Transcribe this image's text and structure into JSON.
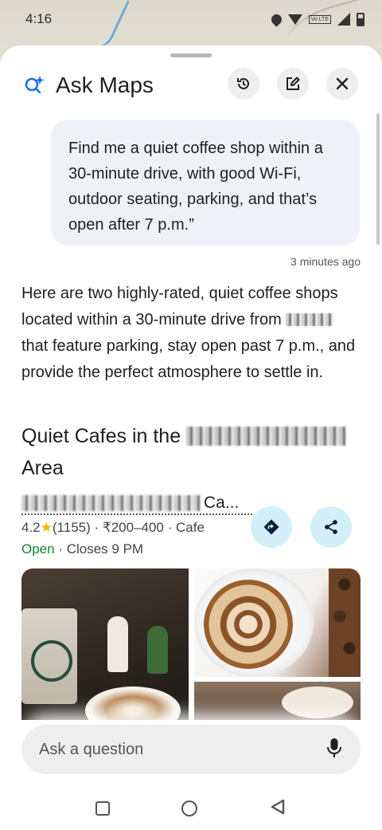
{
  "status_bar": {
    "time": "4:16",
    "icons": [
      "location-icon",
      "wifi-icon",
      "volte-icon",
      "signal-icon",
      "battery-icon"
    ]
  },
  "header": {
    "title": "Ask Maps",
    "icons": [
      "ask-maps-sparkle-icon",
      "history-icon",
      "edit-icon",
      "close-icon"
    ]
  },
  "conversation": {
    "user_message": "Find me a quiet coffee shop within a 30-minute drive, with good Wi-Fi, outdoor seating, parking, and that’s open after 7 p.m.”",
    "timestamp": "3 minutes ago",
    "answer_part1": "Here are two highly-rated, quiet coffee shops located within a 30-minute drive from ",
    "answer_part2": " that feature parking, stay open past 7 p.m., and provide the perfect atmosphere to settle in."
  },
  "section": {
    "title_start": "Quiet Cafes in the ",
    "title_end": "Area"
  },
  "place": {
    "name_suffix": "Ca...",
    "rating": "4.2",
    "reviews": "(1155)",
    "price": "₹200–400",
    "category": "Cafe",
    "status_open": "Open",
    "closes": "Closes 9 PM",
    "separator": " · "
  },
  "input": {
    "placeholder": "Ask a question"
  },
  "colors": {
    "accent_blue": "#1a73e8",
    "open_green": "#188038",
    "star_yellow": "#f4b400",
    "action_button_bg": "#d3f0f8",
    "user_bubble_bg": "#eef2f7"
  }
}
